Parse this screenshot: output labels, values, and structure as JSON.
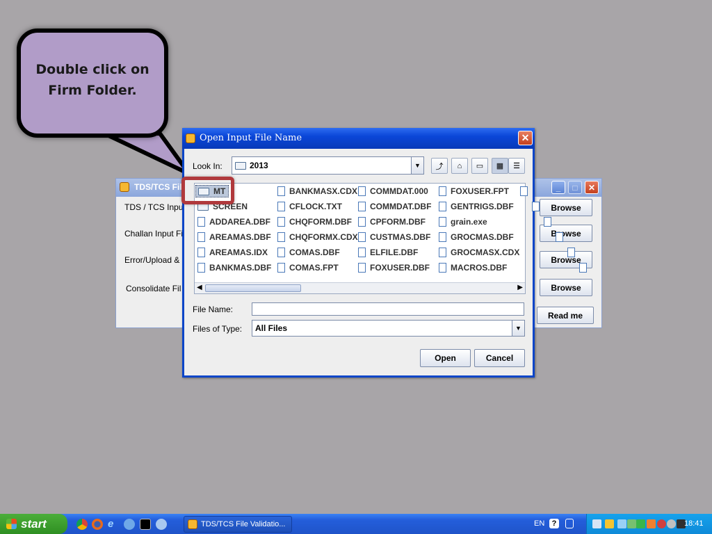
{
  "callout": {
    "line1": "Double click on",
    "line2": "Firm Folder."
  },
  "bg_window": {
    "title": "TDS/TCS Fil",
    "labels": [
      "TDS / TCS Input",
      "Challan Input Fi",
      "Error/Upload &",
      "Consolidate Fil"
    ],
    "browse_label": "Browse",
    "readme_label": "Read me"
  },
  "dialog": {
    "title": "Open Input File Name",
    "look_in_label": "Look In:",
    "look_in_value": "2013",
    "file_name_label": "File Name:",
    "file_name_value": "",
    "files_of_type_label": "Files of Type:",
    "files_of_type_value": "All Files",
    "open_label": "Open",
    "cancel_label": "Cancel",
    "columns": [
      [
        {
          "name": "MT",
          "type": "folder",
          "selected": true
        },
        {
          "name": "SCREEN",
          "type": "folder"
        },
        {
          "name": "ADDAREA.DBF",
          "type": "file"
        },
        {
          "name": "AREAMAS.DBF",
          "type": "file"
        },
        {
          "name": "AREAMAS.IDX",
          "type": "file"
        },
        {
          "name": "BANKMAS.DBF",
          "type": "file"
        }
      ],
      [
        {
          "name": "BANKMASX.CDX",
          "type": "file"
        },
        {
          "name": "CFLOCK.TXT",
          "type": "file"
        },
        {
          "name": "CHQFORM.DBF",
          "type": "file"
        },
        {
          "name": "CHQFORMX.CDX",
          "type": "file"
        },
        {
          "name": "COMAS.DBF",
          "type": "file"
        },
        {
          "name": "COMAS.FPT",
          "type": "file"
        }
      ],
      [
        {
          "name": "COMMDAT.000",
          "type": "file"
        },
        {
          "name": "COMMDAT.DBF",
          "type": "file"
        },
        {
          "name": "CPFORM.DBF",
          "type": "file"
        },
        {
          "name": "CUSTMAS.DBF",
          "type": "file"
        },
        {
          "name": "ELFILE.DBF",
          "type": "file"
        },
        {
          "name": "FOXUSER.DBF",
          "type": "file"
        }
      ],
      [
        {
          "name": "FOXUSER.FPT",
          "type": "file"
        },
        {
          "name": "GENTRIGS.DBF",
          "type": "file"
        },
        {
          "name": "grain.exe",
          "type": "file"
        },
        {
          "name": "GROCMAS.DBF",
          "type": "file"
        },
        {
          "name": "GROCMASX.CDX",
          "type": "file"
        },
        {
          "name": "MACROS.DBF",
          "type": "file"
        }
      ]
    ]
  },
  "taskbar": {
    "start_label": "start",
    "task_label": "TDS/TCS File Validatio...",
    "lang": "EN",
    "clock": "18:41"
  },
  "colors": {
    "callout_fill": "#b19cc8",
    "highlight": "#b0393c",
    "titlebar": "#0a46d8",
    "desktop": "#a8a5a8"
  }
}
